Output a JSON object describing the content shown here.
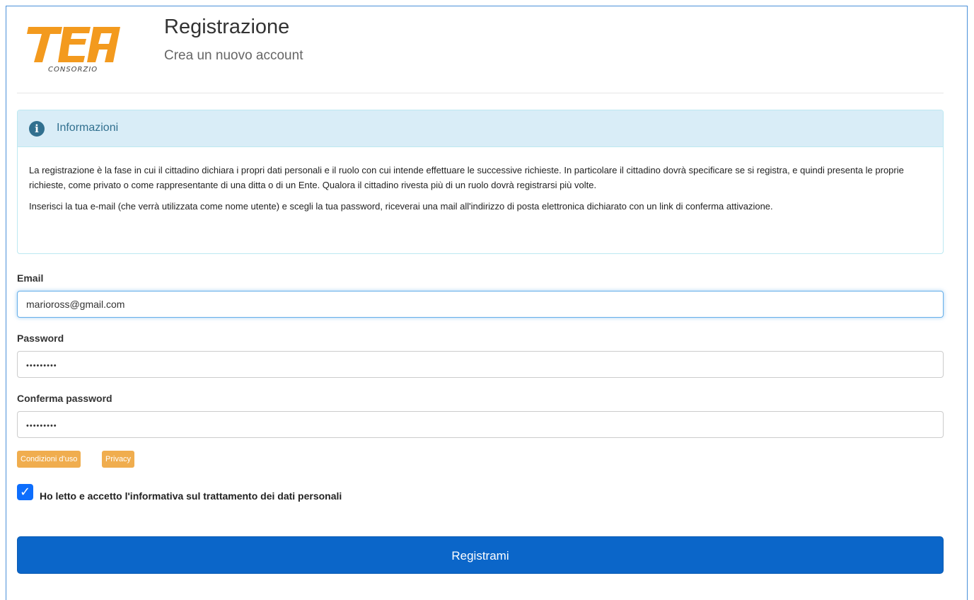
{
  "header": {
    "logo_text": "TEA",
    "logo_subtext": "CONSORZIO",
    "title": "Registrazione",
    "subtitle": "Crea un nuovo account"
  },
  "info": {
    "title": "Informazioni",
    "paragraph1": "La registrazione è la fase in cui il cittadino dichiara i propri dati personali e il ruolo con cui intende effettuare le successive richieste. In particolare il cittadino dovrà specificare se si registra, e quindi presenta le proprie richieste, come privato o come rappresentante di una ditta o di un Ente. Qualora il cittadino rivesta più di un ruolo dovrà registrarsi più volte.",
    "paragraph2": "Inserisci la tua e-mail (che verrà utilizzata come nome utente) e scegli la tua password, riceverai una mail all'indirizzo di posta elettronica dichiarato con un link di conferma attivazione."
  },
  "form": {
    "email_label": "Email",
    "email_value": "marioross@gmail.com",
    "password_label": "Password",
    "password_value": "•••••••••",
    "confirm_label": "Conferma password",
    "confirm_value": "•••••••••",
    "terms_button": "Condizioni d'uso",
    "privacy_button": "Privacy",
    "consent_label": "Ho letto e accetto l'informativa sul trattamento dei dati personali",
    "consent_checked": true,
    "submit_label": "Registrami"
  },
  "colors": {
    "accent": "#0b66c9",
    "info_bg": "#d9edf7",
    "info_text": "#31708f",
    "tag": "#f0ad4e",
    "checkbox": "#0d6efd"
  }
}
